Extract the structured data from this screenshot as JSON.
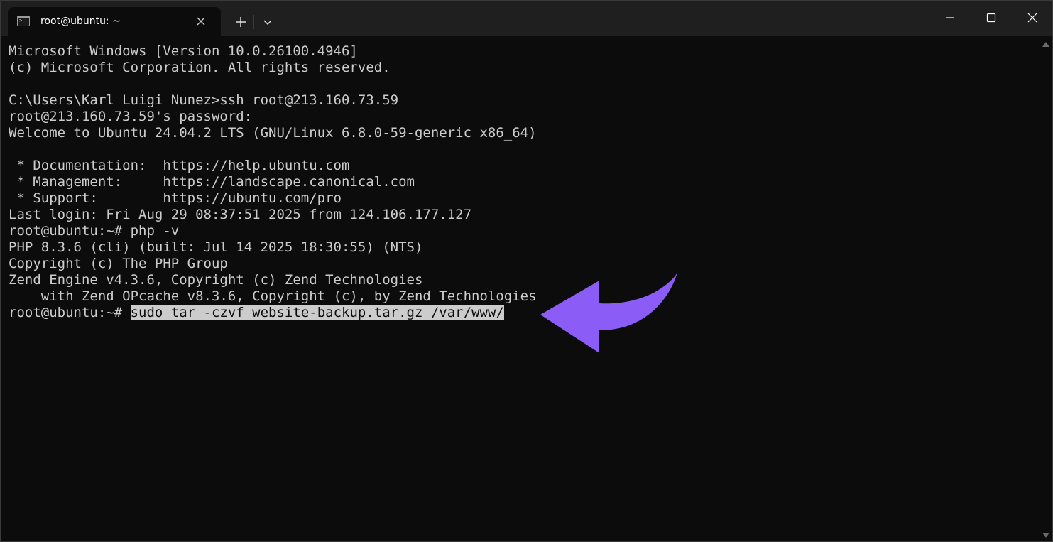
{
  "titlebar": {
    "tab_title": "root@ubuntu: ~",
    "icons": {
      "tab": "terminal-icon",
      "close_tab": "close-icon",
      "new_tab": "plus-icon",
      "dropdown": "chevron-down-icon",
      "minimize": "minimize-icon",
      "maximize": "maximize-icon",
      "close_window": "close-icon"
    }
  },
  "terminal": {
    "lines": [
      "Microsoft Windows [Version 10.0.26100.4946]",
      "(c) Microsoft Corporation. All rights reserved.",
      "",
      "C:\\Users\\Karl Luigi Nunez>ssh root@213.160.73.59",
      "root@213.160.73.59's password:",
      "Welcome to Ubuntu 24.04.2 LTS (GNU/Linux 6.8.0-59-generic x86_64)",
      "",
      " * Documentation:  https://help.ubuntu.com",
      " * Management:     https://landscape.canonical.com",
      " * Support:        https://ubuntu.com/pro",
      "Last login: Fri Aug 29 08:37:51 2025 from 124.106.177.127",
      "root@ubuntu:~# php -v",
      "PHP 8.3.6 (cli) (built: Jul 14 2025 18:30:55) (NTS)",
      "Copyright (c) The PHP Group",
      "Zend Engine v4.3.6, Copyright (c) Zend Technologies",
      "    with Zend OPcache v8.3.6, Copyright (c), by Zend Technologies"
    ],
    "current_prompt": "root@ubuntu:~# ",
    "current_command": "sudo tar -czvf website-backup.tar.gz /var/www/"
  },
  "colors": {
    "background": "#0c0c0c",
    "titlebar": "#1f1f1f",
    "text": "#cccccc",
    "highlight": "#cccccc",
    "annotation_arrow": "#8b5cf6"
  }
}
